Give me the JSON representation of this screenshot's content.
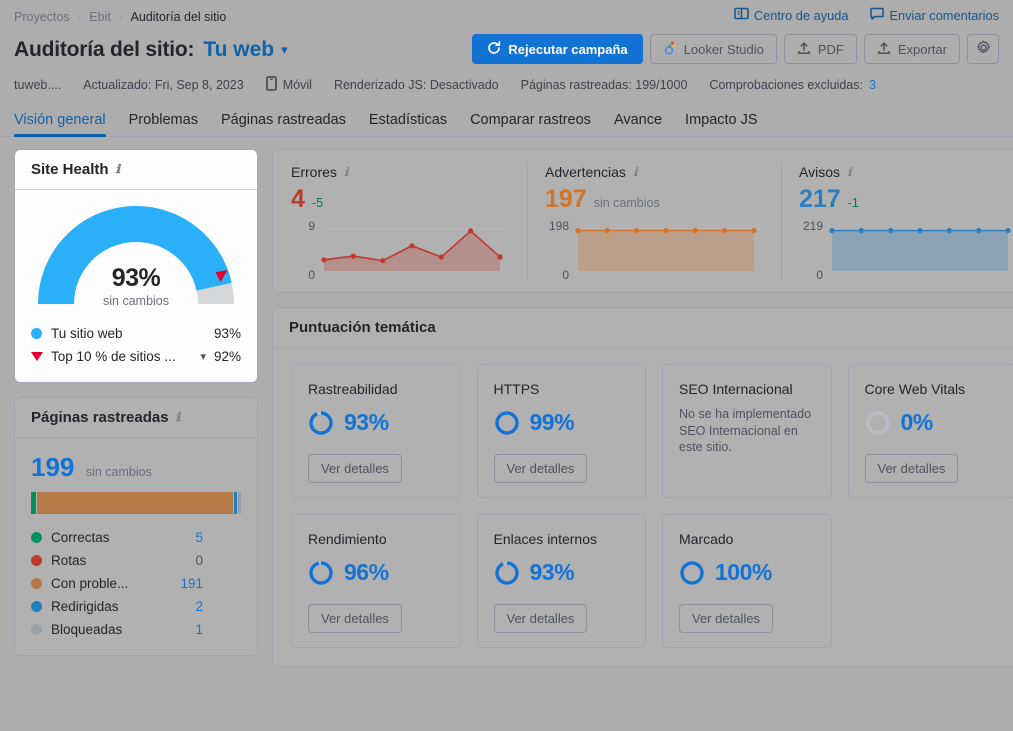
{
  "breadcrumb": {
    "items": [
      "Proyectos",
      "Ebit",
      "Auditoría del sitio"
    ],
    "separator": "›"
  },
  "help": {
    "center_label": "Centro de ayuda",
    "feedback_label": "Enviar comentarios",
    "center_icon": "book-icon",
    "feedback_icon": "comment-icon"
  },
  "header": {
    "title": "Auditoría del sitio:",
    "site": "Tu web",
    "caret_icon": "chevron-down-icon"
  },
  "actions": {
    "rerun_label": "Rejecutar campaña",
    "rerun_icon": "refresh-icon",
    "looker_label": "Looker Studio",
    "looker_icon": "looker-icon",
    "pdf_label": "PDF",
    "pdf_icon": "upload-icon",
    "export_label": "Exportar",
    "export_icon": "upload-icon",
    "settings_icon": "gear-icon"
  },
  "meta": {
    "domain": "tuweb....",
    "updated": "Actualizado: Fri, Sep 8, 2023",
    "device": "Móvil",
    "device_icon": "mobile-icon",
    "js_render": "Renderizado JS: Desactivado",
    "crawled": "Páginas rastreadas: 199/1000",
    "excluded_label": "Comprobaciones excluidas:",
    "excluded_value": "3"
  },
  "tabs": [
    {
      "label": "Visión general",
      "active": true
    },
    {
      "label": "Problemas",
      "active": false
    },
    {
      "label": "Páginas rastreadas",
      "active": false
    },
    {
      "label": "Estadísticas",
      "active": false
    },
    {
      "label": "Comparar rastreos",
      "active": false
    },
    {
      "label": "Avance",
      "active": false
    },
    {
      "label": "Impacto JS",
      "active": false
    }
  ],
  "site_health": {
    "title": "Site Health",
    "info_icon": "info-icon",
    "percent": "93%",
    "change": "sin cambios",
    "gauge_value": 93,
    "benchmark_value": 92,
    "legend": [
      {
        "label": "Tu sitio web",
        "value": "93%",
        "marker": "dot",
        "color": "#2ab0f9"
      },
      {
        "label": "Top 10 % de sitios ...",
        "value": "92%",
        "marker": "triangle",
        "color": "#e4002b",
        "has_caret": true
      }
    ]
  },
  "pages_crawled": {
    "title": "Páginas rastreadas",
    "info_icon": "info-icon",
    "total": "199",
    "change": "sin cambios",
    "rows": [
      {
        "label": "Correctas",
        "value": "5",
        "color": "#00a065",
        "count": 5
      },
      {
        "label": "Rotas",
        "value": "0",
        "color": "#c0392f",
        "count": 0
      },
      {
        "label": "Con proble...",
        "value": "191",
        "color": "#c08martin",
        "count": 191
      },
      {
        "label": "Redirigidas",
        "value": "2",
        "color": "#1e7fc2",
        "count": 2
      },
      {
        "label": "Bloqueadas",
        "value": "1",
        "color": "#8f949c",
        "count": 1
      }
    ],
    "bar_colors": [
      "#00915b",
      "#b37a48",
      "#1e7fc2",
      "#9aa0a8"
    ]
  },
  "chart_data": [
    {
      "type": "area",
      "title": "Errores",
      "info_icon": "info-icon",
      "value": "4",
      "delta": "-5",
      "delta_dir": "down",
      "color": "#c0392f",
      "ylim": [
        0,
        9
      ],
      "yticks": [
        "9",
        "0"
      ],
      "x": [
        1,
        2,
        3,
        4,
        5,
        6,
        7
      ],
      "values": [
        2.4,
        3.2,
        2.2,
        5.4,
        3.0,
        8.6,
        3.0
      ]
    },
    {
      "type": "area",
      "title": "Advertencias",
      "info_icon": "info-icon",
      "value": "197",
      "delta": "sin cambios",
      "delta_dir": "flat",
      "color": "#d4742a",
      "ylim": [
        0,
        198
      ],
      "yticks": [
        "198",
        "0"
      ],
      "x": [
        1,
        2,
        3,
        4,
        5,
        6,
        7
      ],
      "values": [
        197,
        197,
        196,
        197,
        197,
        196,
        197
      ]
    },
    {
      "type": "area",
      "title": "Avisos",
      "info_icon": "info-icon",
      "value": "217",
      "delta": "-1",
      "delta_dir": "down",
      "color": "#2a7fc0",
      "ylim": [
        0,
        219
      ],
      "yticks": [
        "219",
        "0"
      ],
      "x": [
        1,
        2,
        3,
        4,
        5,
        6,
        7
      ],
      "values": [
        218,
        217,
        218,
        217,
        218,
        217,
        218
      ]
    }
  ],
  "thematic": {
    "title": "Puntuación temática",
    "details_label": "Ver detalles",
    "cards": [
      {
        "title": "Rastreabilidad",
        "percent": "93%",
        "value": 93,
        "has_score": true,
        "note": ""
      },
      {
        "title": "HTTPS",
        "percent": "99%",
        "value": 99,
        "has_score": true,
        "note": ""
      },
      {
        "title": "SEO Internacional",
        "percent": "",
        "value": 0,
        "has_score": false,
        "note": "No se ha implementado SEO Internacional en este sitio."
      },
      {
        "title": "Core Web Vitals",
        "percent": "0%",
        "value": 0,
        "has_score": true,
        "note": ""
      },
      {
        "title": "Rendimiento",
        "percent": "96%",
        "value": 96,
        "has_score": true,
        "note": ""
      },
      {
        "title": "Enlaces internos",
        "percent": "93%",
        "value": 93,
        "has_score": true,
        "note": ""
      },
      {
        "title": "Marcado",
        "percent": "100%",
        "value": 100,
        "has_score": true,
        "note": ""
      }
    ]
  },
  "colors": {
    "accent": "#1273d4",
    "gauge": "#2ab0f9",
    "error": "#c0392f",
    "warning": "#d4742a",
    "notice": "#2a7fc0",
    "green": "#00754a"
  }
}
